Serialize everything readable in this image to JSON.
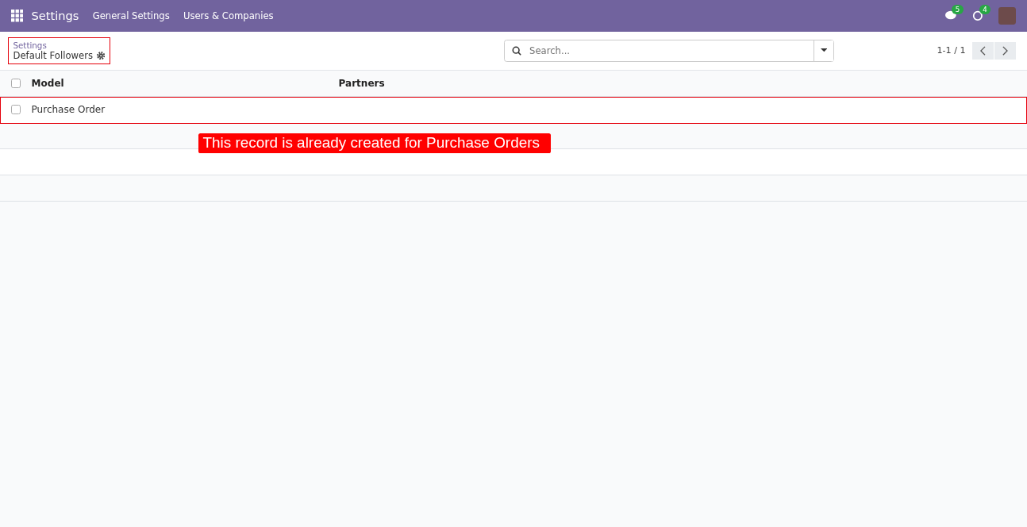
{
  "navbar": {
    "app_title": "Settings",
    "menu": [
      "General Settings",
      "Users & Companies"
    ],
    "messages_count": "5",
    "activities_count": "4"
  },
  "breadcrumb": {
    "parent": "Settings",
    "current": "Default Followers",
    "highlighted": true
  },
  "search": {
    "placeholder": "Search..."
  },
  "pager": {
    "text": "1-1 / 1"
  },
  "table": {
    "columns": [
      "Model",
      "Partners"
    ],
    "header_checked": false,
    "rows": [
      {
        "model": "Purchase Order",
        "partners": "",
        "checked": false,
        "highlighted": true
      }
    ]
  },
  "callout": {
    "text": "This record is already created for Purchase Orders"
  }
}
